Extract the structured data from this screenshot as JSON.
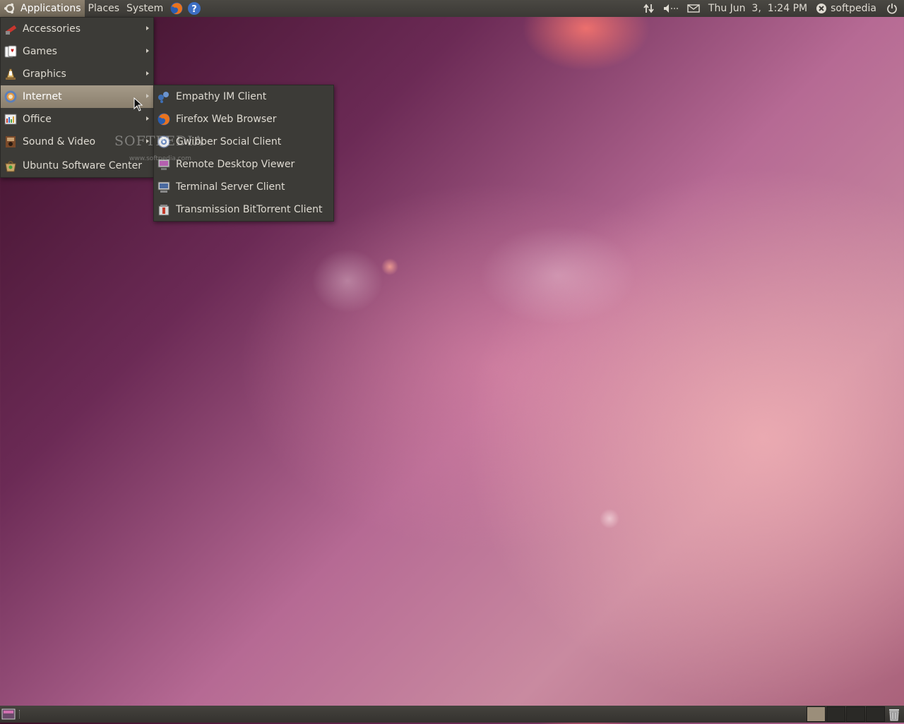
{
  "top_panel": {
    "menus": [
      {
        "label": "Applications",
        "active": true
      },
      {
        "label": "Places"
      },
      {
        "label": "System"
      }
    ],
    "launchers": [
      "firefox-icon",
      "help-icon"
    ],
    "tray": {
      "network_icon": "network-arrows-icon",
      "volume_icon": "speaker-icon",
      "mail_icon": "mail-envelope-icon",
      "clock": "Thu Jun  3,  1:24 PM",
      "user": "softpedia",
      "power_icon": "power-icon"
    }
  },
  "applications_menu": {
    "items": [
      {
        "label": "Accessories",
        "icon": "accessories-icon",
        "submenu": true
      },
      {
        "label": "Games",
        "icon": "games-icon",
        "submenu": true
      },
      {
        "label": "Graphics",
        "icon": "graphics-icon",
        "submenu": true
      },
      {
        "label": "Internet",
        "icon": "internet-icon",
        "submenu": true,
        "highlighted": true
      },
      {
        "label": "Office",
        "icon": "office-icon",
        "submenu": true
      },
      {
        "label": "Sound & Video",
        "icon": "sound-video-icon",
        "submenu": true
      },
      {
        "label": "Ubuntu Software Center",
        "icon": "software-center-icon",
        "submenu": false
      }
    ]
  },
  "internet_submenu": {
    "items": [
      {
        "label": "Empathy IM Client",
        "icon": "empathy-icon"
      },
      {
        "label": "Firefox Web Browser",
        "icon": "firefox-icon"
      },
      {
        "label": "Gwibber Social Client",
        "icon": "gwibber-icon"
      },
      {
        "label": "Remote Desktop Viewer",
        "icon": "remote-desktop-icon"
      },
      {
        "label": "Terminal Server Client",
        "icon": "terminal-server-icon"
      },
      {
        "label": "Transmission BitTorrent Client",
        "icon": "transmission-icon"
      }
    ]
  },
  "watermark": {
    "text": "SOFTPEDIA",
    "url": "www.softpedia.com"
  },
  "colors": {
    "panel": "#3c3b37",
    "highlight": "#a59a88",
    "accent": "#dd4814"
  }
}
